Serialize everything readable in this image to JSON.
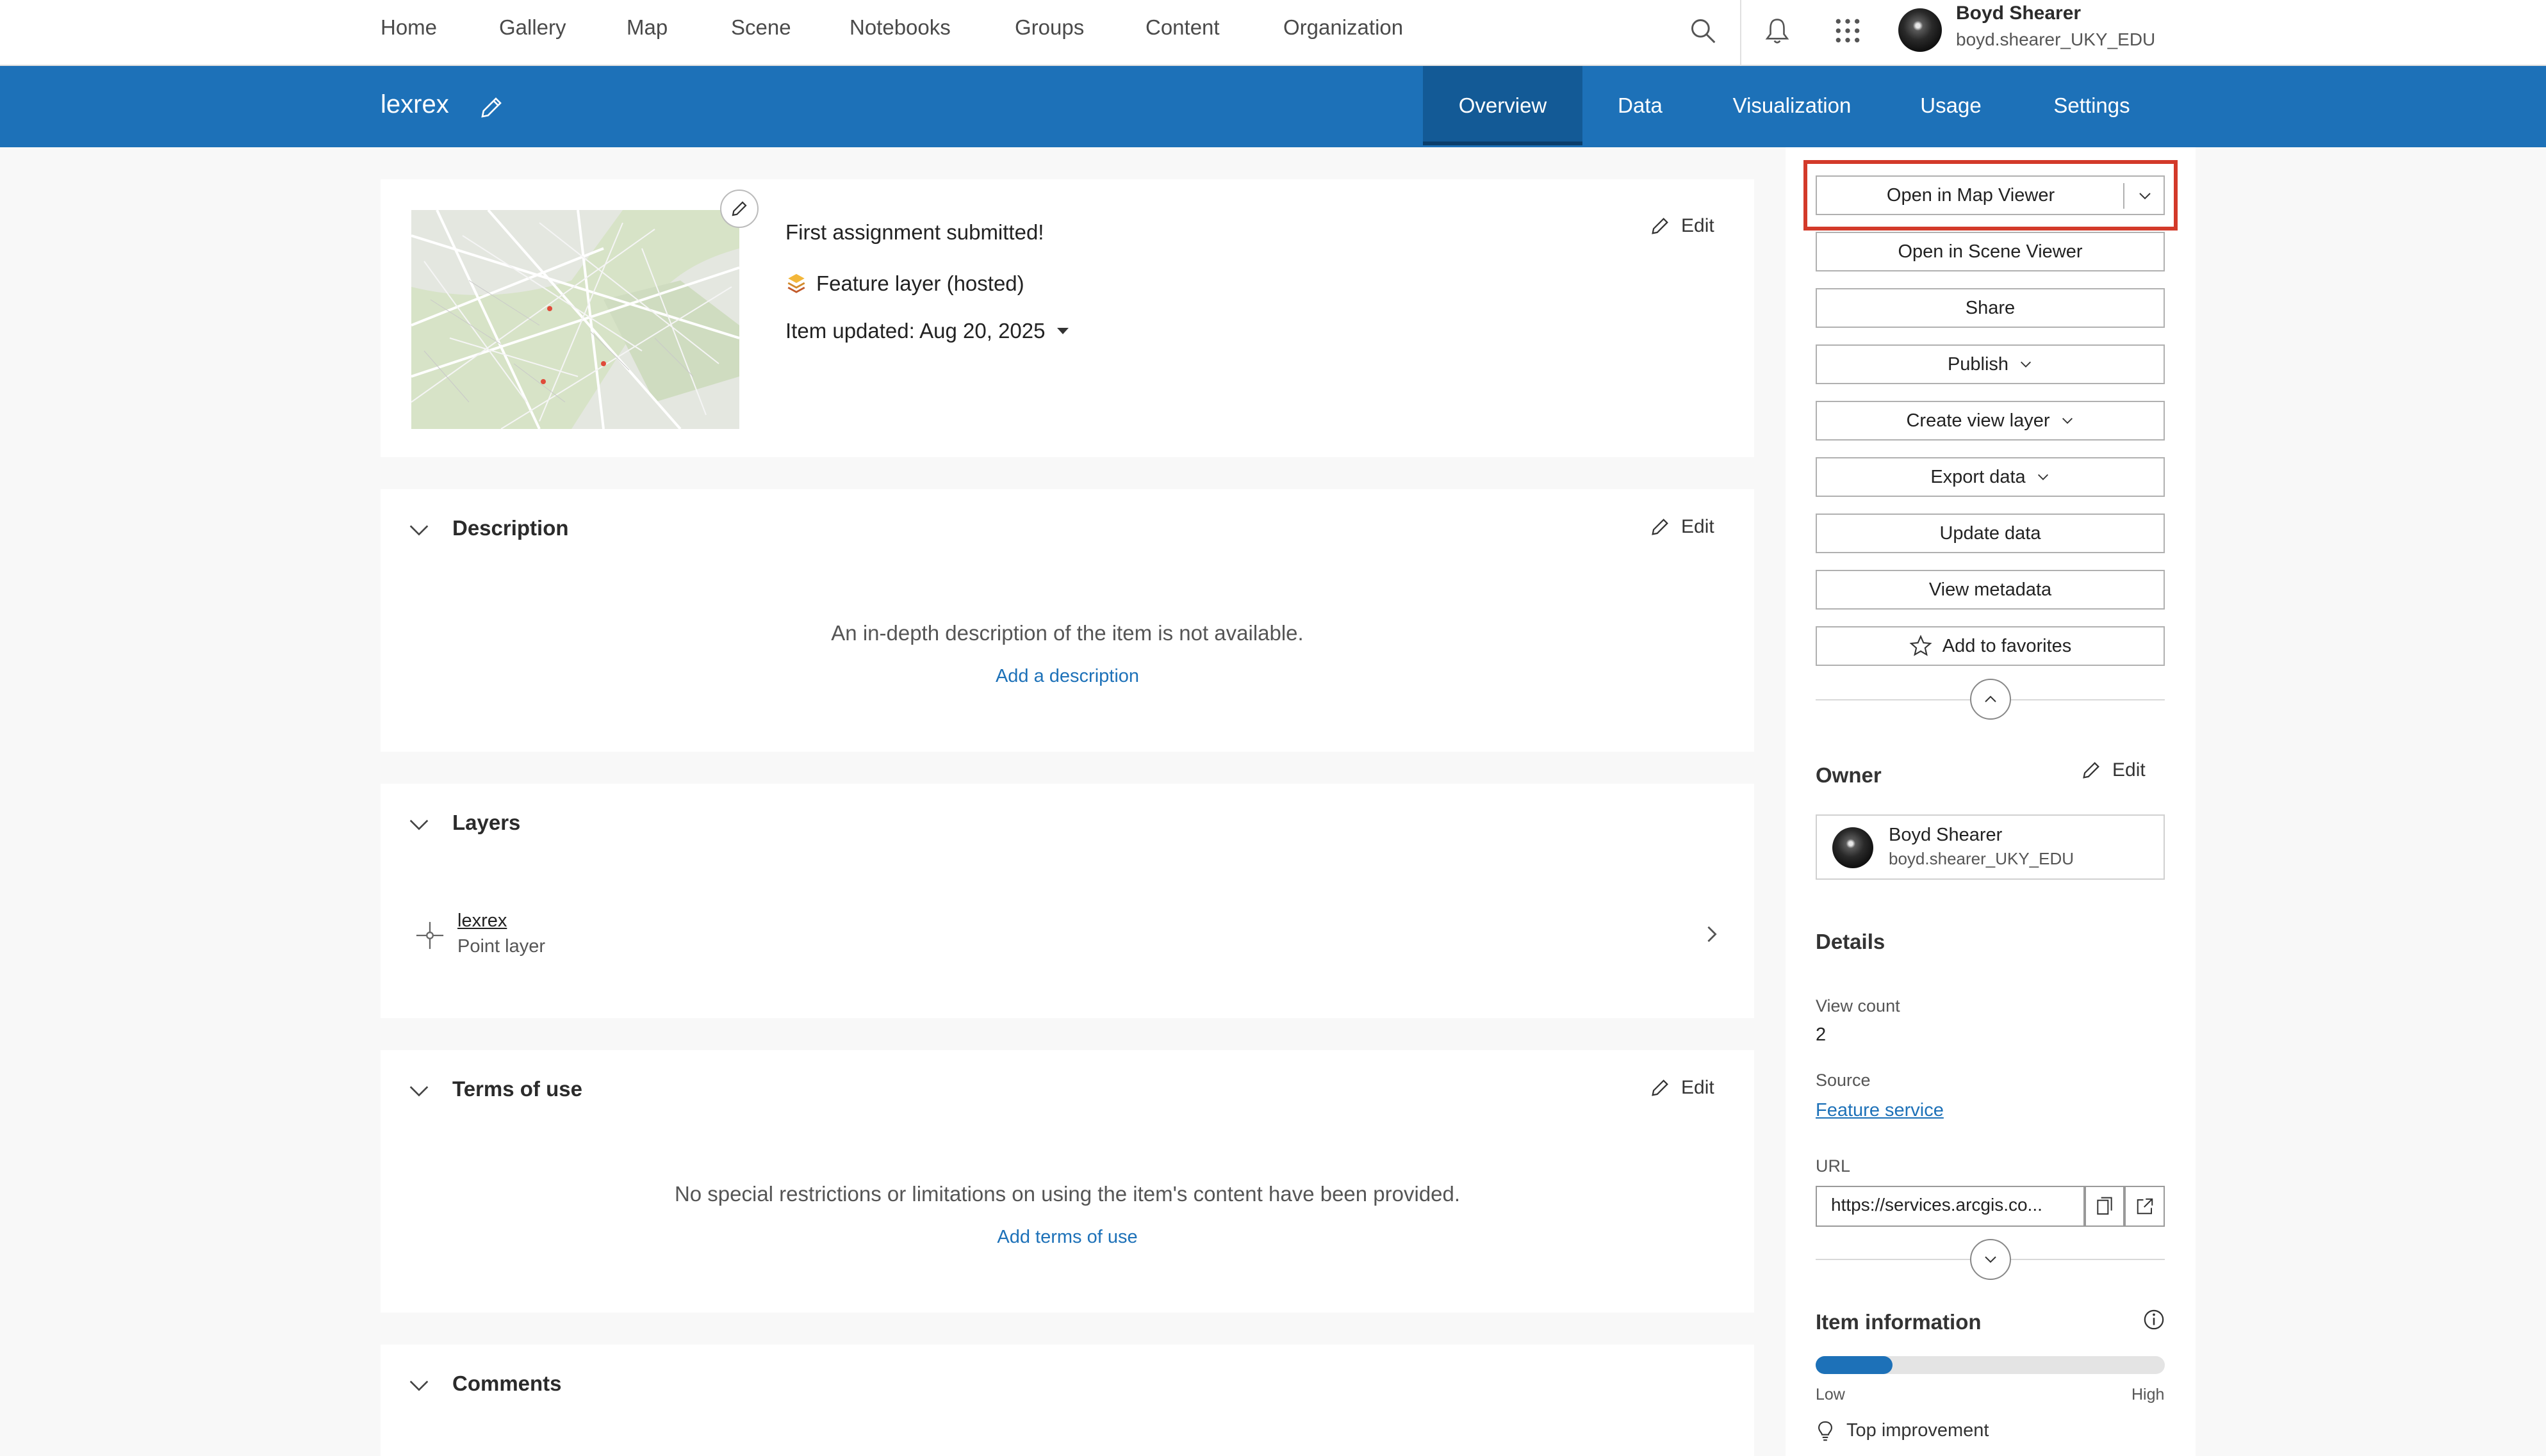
{
  "nav": {
    "items": [
      "Home",
      "Gallery",
      "Map",
      "Scene",
      "Notebooks",
      "Groups",
      "Content",
      "Organization"
    ],
    "user_name": "Boyd Shearer",
    "user_id": "boyd.shearer_UKY_EDU"
  },
  "header": {
    "title": "lexrex",
    "tabs": [
      "Overview",
      "Data",
      "Visualization",
      "Usage",
      "Settings"
    ],
    "active_tab": "Overview"
  },
  "summary": {
    "snippet": "First assignment submitted!",
    "type_label": "Feature layer (hosted)",
    "updated": "Item updated: Aug 20, 2025",
    "edit": "Edit"
  },
  "description": {
    "title": "Description",
    "edit": "Edit",
    "empty_text": "An in-depth description of the item is not available.",
    "add_link": "Add a description"
  },
  "layers": {
    "title": "Layers",
    "items": [
      {
        "name": "lexrex",
        "type": "Point layer"
      }
    ]
  },
  "terms": {
    "title": "Terms of use",
    "edit": "Edit",
    "empty_text": "No special restrictions or limitations on using the item's content have been provided.",
    "add_link": "Add terms of use"
  },
  "comments": {
    "title": "Comments"
  },
  "sidebar": {
    "buttons": {
      "open_map_viewer": "Open in Map Viewer",
      "open_scene_viewer": "Open in Scene Viewer",
      "share": "Share",
      "publish": "Publish",
      "create_view_layer": "Create view layer",
      "export_data": "Export data",
      "update_data": "Update data",
      "view_metadata": "View metadata",
      "add_favorites": "Add to favorites"
    },
    "owner": {
      "heading": "Owner",
      "edit": "Edit",
      "name": "Boyd Shearer",
      "id": "boyd.shearer_UKY_EDU"
    },
    "details": {
      "heading": "Details",
      "view_count_label": "View count",
      "view_count": "2",
      "source_label": "Source",
      "source": "Feature service",
      "url_label": "URL",
      "url": "https://services.arcgis.co..."
    },
    "item_info": {
      "heading": "Item information",
      "low": "Low",
      "high": "High",
      "level": 0.22,
      "top_improvement": "Top improvement"
    }
  },
  "colors": {
    "brand_blue": "#1d71b8",
    "active_tab": "#135a96",
    "highlight_red": "#d33a2a"
  }
}
